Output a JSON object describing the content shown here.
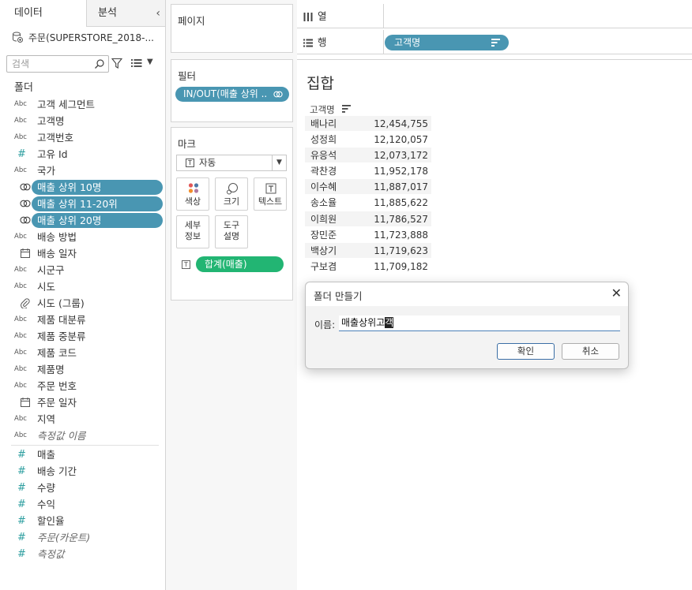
{
  "tabs": {
    "data": "데이터",
    "analysis": "분석",
    "collapse": "‹"
  },
  "datasource": {
    "name": "주문(SUPERSTORE_2018-..."
  },
  "search": {
    "placeholder": "검색"
  },
  "folders_label": "폴더",
  "fields": [
    {
      "icon": "Abc",
      "label": "고객 세그먼트"
    },
    {
      "icon": "Abc",
      "label": "고객명"
    },
    {
      "icon": "Abc",
      "label": "고객번호"
    },
    {
      "icon": "#",
      "label": "고유 Id"
    },
    {
      "icon": "Abc",
      "label": "국가"
    },
    {
      "icon": "set",
      "label": "매출 상위 10명",
      "selected": true
    },
    {
      "icon": "set",
      "label": "매출 상위 11-20위",
      "selected": true
    },
    {
      "icon": "set",
      "label": "매출 상위 20명",
      "selected": true
    },
    {
      "icon": "Abc",
      "label": "배송 방법"
    },
    {
      "icon": "calendar",
      "label": "배송 일자"
    },
    {
      "icon": "Abc",
      "label": "시군구"
    },
    {
      "icon": "Abc",
      "label": "시도"
    },
    {
      "icon": "paperclip",
      "label": "시도 (그룹)"
    },
    {
      "icon": "Abc",
      "label": "제품 대분류"
    },
    {
      "icon": "Abc",
      "label": "제품 중분류"
    },
    {
      "icon": "Abc",
      "label": "제품 코드"
    },
    {
      "icon": "Abc",
      "label": "제품명"
    },
    {
      "icon": "Abc",
      "label": "주문 번호"
    },
    {
      "icon": "calendar",
      "label": "주문 일자"
    },
    {
      "icon": "Abc",
      "label": "지역"
    },
    {
      "icon": "Abc",
      "label": "측정값 이름",
      "italic": true
    }
  ],
  "measures": [
    {
      "icon": "#",
      "label": "매출"
    },
    {
      "icon": "#",
      "label": "배송 기간"
    },
    {
      "icon": "#",
      "label": "수량"
    },
    {
      "icon": "#",
      "label": "수익"
    },
    {
      "icon": "#",
      "label": "할인율"
    },
    {
      "icon": "#",
      "label": "주문(카운트)",
      "italic": true
    },
    {
      "icon": "#",
      "label": "측정값",
      "italic": true
    }
  ],
  "shelves": {
    "pages": "페이지",
    "filters": "필터",
    "filter_pill": "IN/OUT(매출 상위 ..",
    "marks": "마크",
    "mark_type": "자동",
    "mark_type_icon": "T",
    "mark_buttons": {
      "color": "색상",
      "size": "크기",
      "text": "텍스트",
      "detail_1": "세부",
      "detail_2": "정보",
      "tooltip_1": "도구",
      "tooltip_2": "설명"
    },
    "mark_pill": "합계(매출)",
    "mark_pill_icon": "T"
  },
  "columns_label": "열",
  "rows_label": "행",
  "rows_pill": "고객명",
  "sheet": {
    "title": "집합",
    "column_header": "고객명",
    "rows": [
      {
        "name": "배나리",
        "value": "12,454,755"
      },
      {
        "name": "성정희",
        "value": "12,120,057"
      },
      {
        "name": "유응석",
        "value": "12,073,172"
      },
      {
        "name": "곽찬경",
        "value": "11,952,178"
      },
      {
        "name": "이수혜",
        "value": "11,887,017"
      },
      {
        "name": "송소율",
        "value": "11,885,622"
      },
      {
        "name": "이희원",
        "value": "11,786,527"
      },
      {
        "name": "장민준",
        "value": "11,723,888"
      },
      {
        "name": "백상기",
        "value": "11,719,623"
      },
      {
        "name": "구보겸",
        "value": "11,709,182"
      }
    ]
  },
  "dialog": {
    "title": "폴더 만들기",
    "close": "✕",
    "name_label": "이름:",
    "name_value": "매출상위고",
    "name_composing": "객",
    "ok": "확인",
    "cancel": "취소"
  },
  "colors": {
    "blue_pill": "#4996b2",
    "green_pill": "#22b573",
    "accent": "#3a6ea5"
  }
}
